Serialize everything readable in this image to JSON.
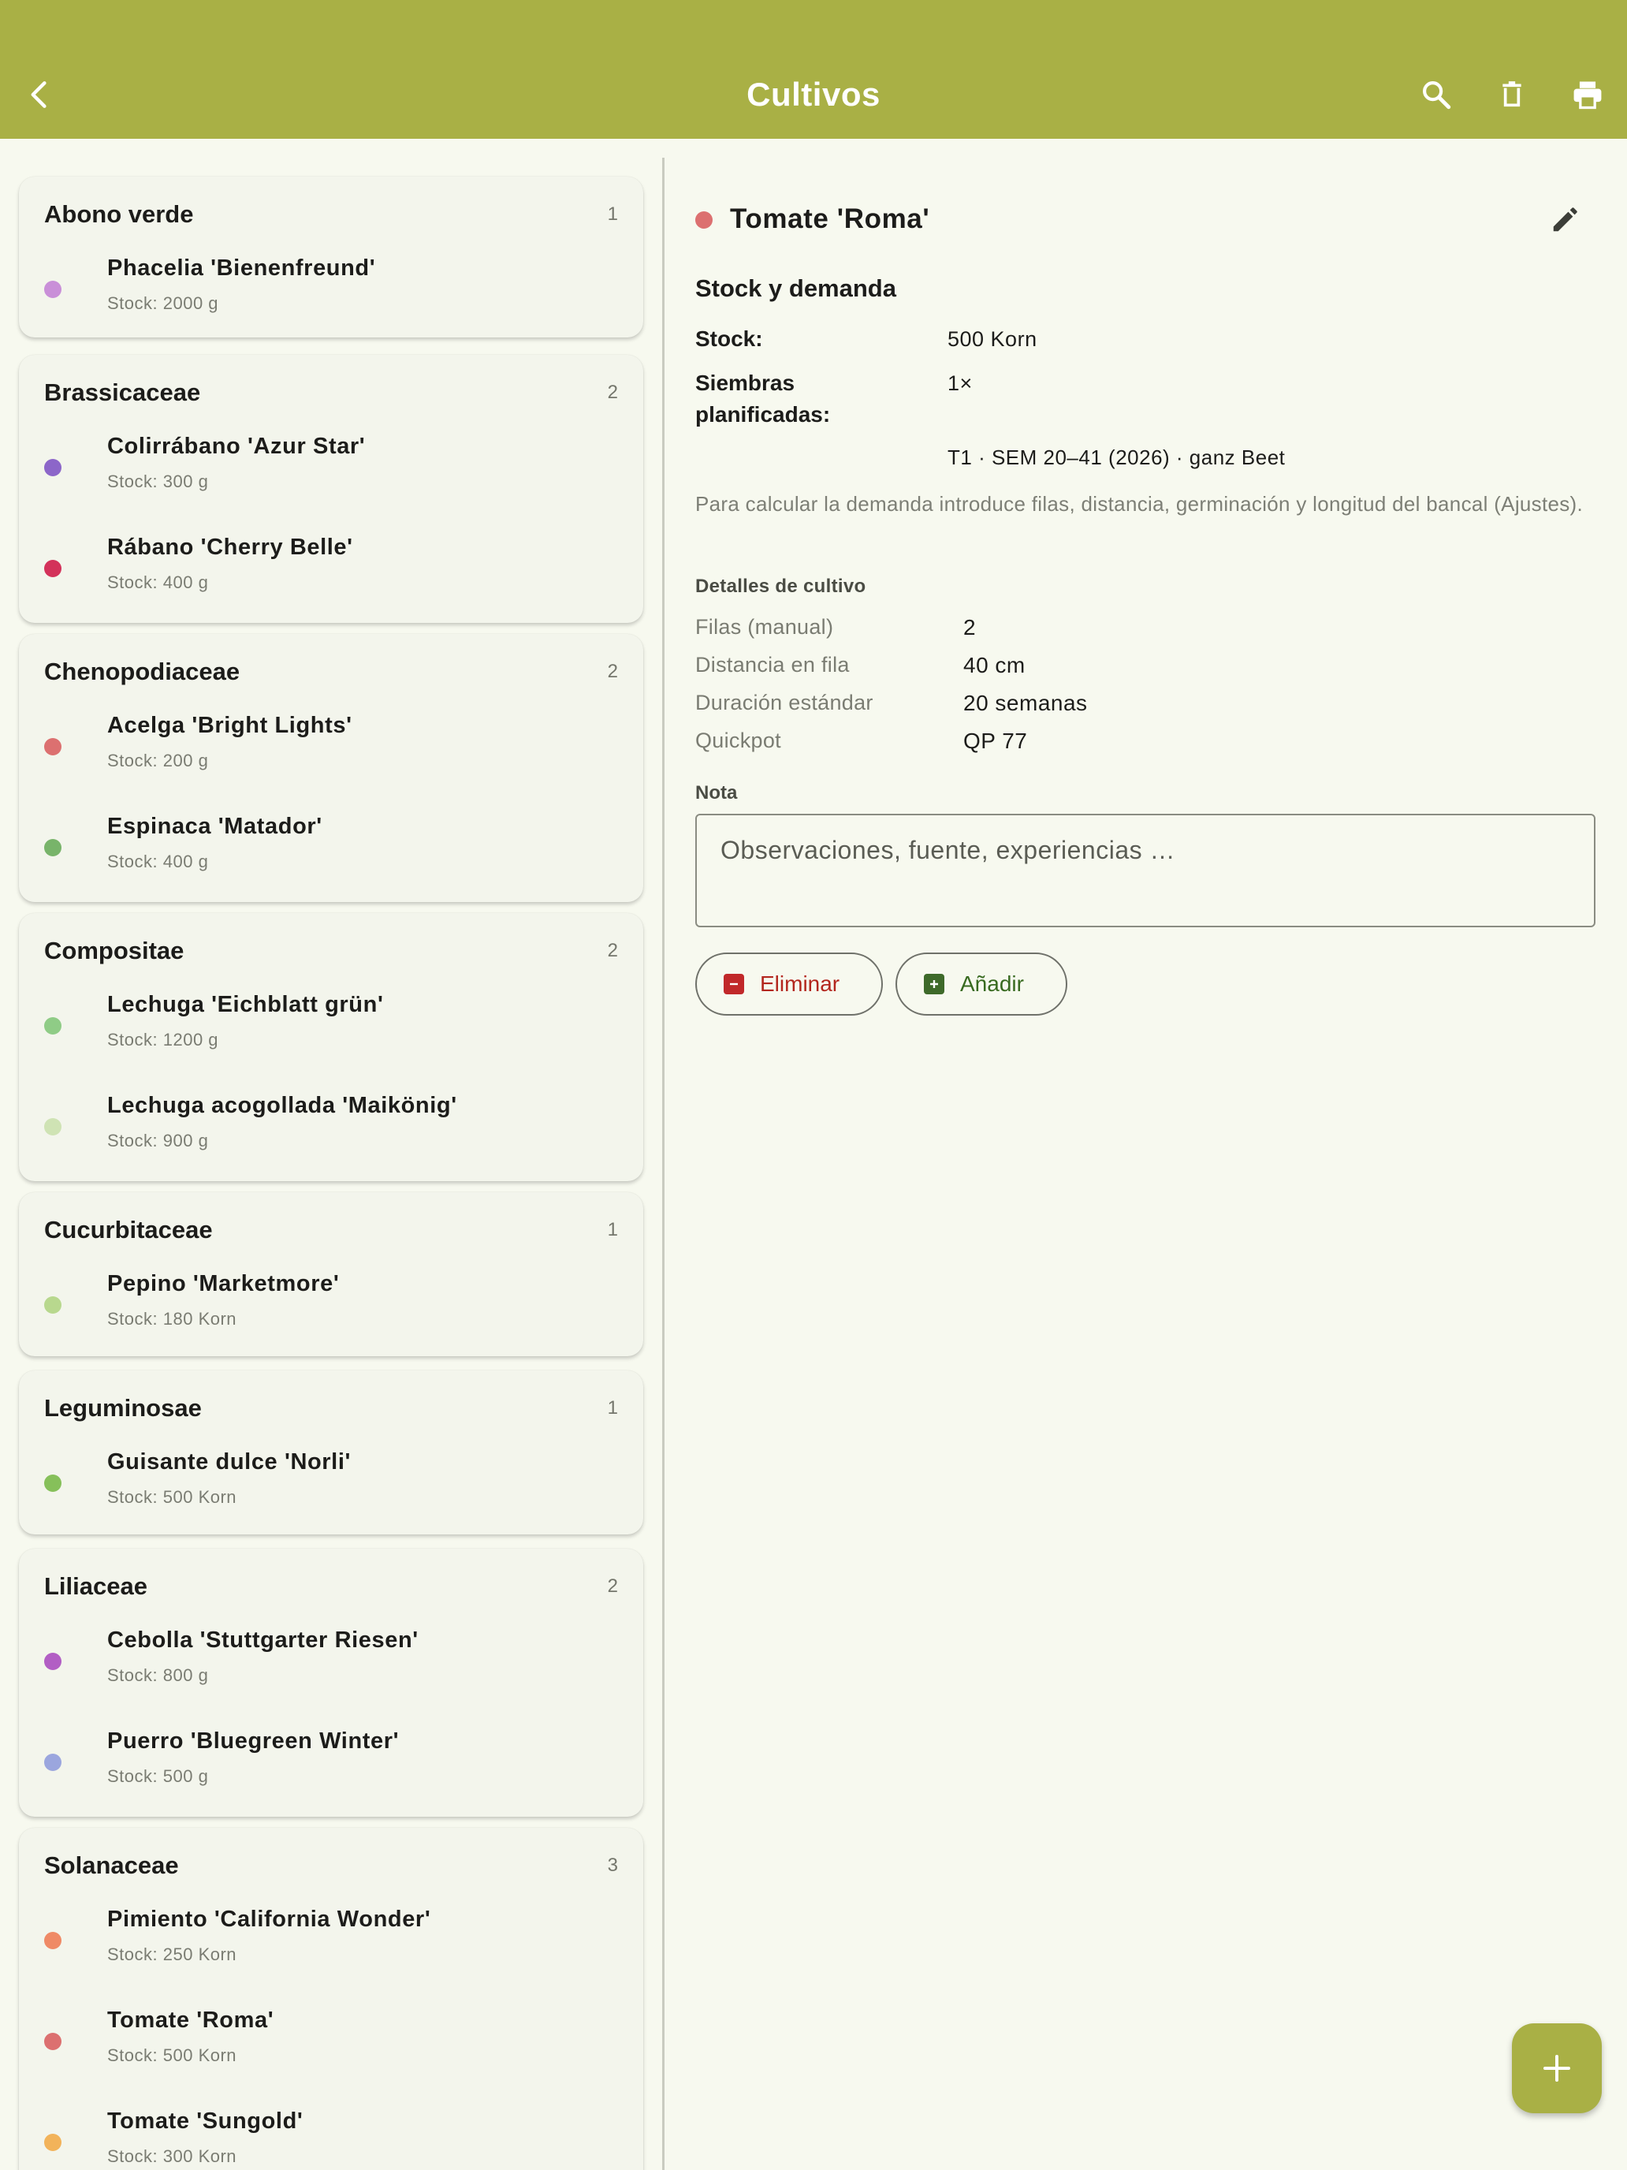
{
  "appbar": {
    "title": "Cultivos",
    "color": "#a9b045",
    "icons": [
      "back-arrow-icon",
      "search-icon",
      "delete-icon",
      "print-icon"
    ]
  },
  "groups": [
    {
      "name": "Abono verde",
      "count": "1",
      "items": [
        {
          "name": "Phacelia 'Bienenfreund'",
          "stock": "Stock: 2000 g",
          "color": "#c98fd8"
        }
      ]
    },
    {
      "name": "Brassicaceae",
      "count": "2",
      "items": [
        {
          "name": "Colirrábano 'Azur Star'",
          "stock": "Stock: 300 g",
          "color": "#8c66c9"
        },
        {
          "name": "Rábano 'Cherry Belle'",
          "stock": "Stock: 400 g",
          "color": "#d3325a"
        }
      ]
    },
    {
      "name": "Chenopodiaceae",
      "count": "2",
      "items": [
        {
          "name": "Acelga 'Bright Lights'",
          "stock": "Stock: 200 g",
          "color": "#dc7070"
        },
        {
          "name": "Espinaca 'Matador'",
          "stock": "Stock: 400 g",
          "color": "#78b46a"
        }
      ]
    },
    {
      "name": "Compositae",
      "count": "2",
      "items": [
        {
          "name": "Lechuga 'Eichblatt grün'",
          "stock": "Stock: 1200 g",
          "color": "#8fcc86"
        },
        {
          "name": "Lechuga acogollada 'Maikönig'",
          "stock": "Stock: 900 g",
          "color": "#cfe3b4"
        }
      ]
    },
    {
      "name": "Cucurbitaceae",
      "count": "1",
      "items": [
        {
          "name": "Pepino 'Marketmore'",
          "stock": "Stock: 180 Korn",
          "color": "#b8d88e"
        }
      ]
    },
    {
      "name": "Leguminosae",
      "count": "1",
      "items": [
        {
          "name": "Guisante dulce 'Norli'",
          "stock": "Stock: 500 Korn",
          "color": "#86c05a"
        }
      ]
    },
    {
      "name": "Liliaceae",
      "count": "2",
      "items": [
        {
          "name": "Cebolla 'Stuttgarter Riesen'",
          "stock": "Stock: 800 g",
          "color": "#b25ec4"
        },
        {
          "name": "Puerro 'Bluegreen Winter'",
          "stock": "Stock: 500 g",
          "color": "#9ba6de"
        }
      ]
    },
    {
      "name": "Solanaceae",
      "count": "3",
      "items": [
        {
          "name": "Pimiento 'California Wonder'",
          "stock": "Stock: 250 Korn",
          "color": "#ef8a66"
        },
        {
          "name": "Tomate 'Roma'",
          "stock": "Stock: 500 Korn",
          "color": "#dc7070"
        },
        {
          "name": "Tomate 'Sungold'",
          "stock": "Stock: 300 Korn",
          "color": "#f2b35a"
        }
      ]
    }
  ],
  "detail": {
    "title": "Tomate 'Roma'",
    "color": "#dc7070",
    "section_title": "Stock y demanda",
    "stock_label": "Stock:",
    "stock_value": "500 Korn",
    "sowings_label_1": "Siembras",
    "sowings_label_2": "planificadas:",
    "sowings_value": "1×",
    "sowing_entry": "T1 · SEM 20–41 (2026) · ganz Beet",
    "hint": "Para calcular la demanda introduce filas, distancia, germinación y longitud del bancal (Ajustes).",
    "details_title": "Detalles de cultivo",
    "details": [
      {
        "label": "Filas (manual)",
        "value": "2"
      },
      {
        "label": "Distancia en fila",
        "value": "40 cm"
      },
      {
        "label": "Duración estándar",
        "value": "20 semanas"
      },
      {
        "label": "Quickpot",
        "value": "QP 77"
      }
    ],
    "note_label": "Nota",
    "note_placeholder": "Observaciones, fuente, experiencias …",
    "remove_label": "Eliminar",
    "add_label": "Añadir"
  },
  "fab_icon": "plus-icon"
}
